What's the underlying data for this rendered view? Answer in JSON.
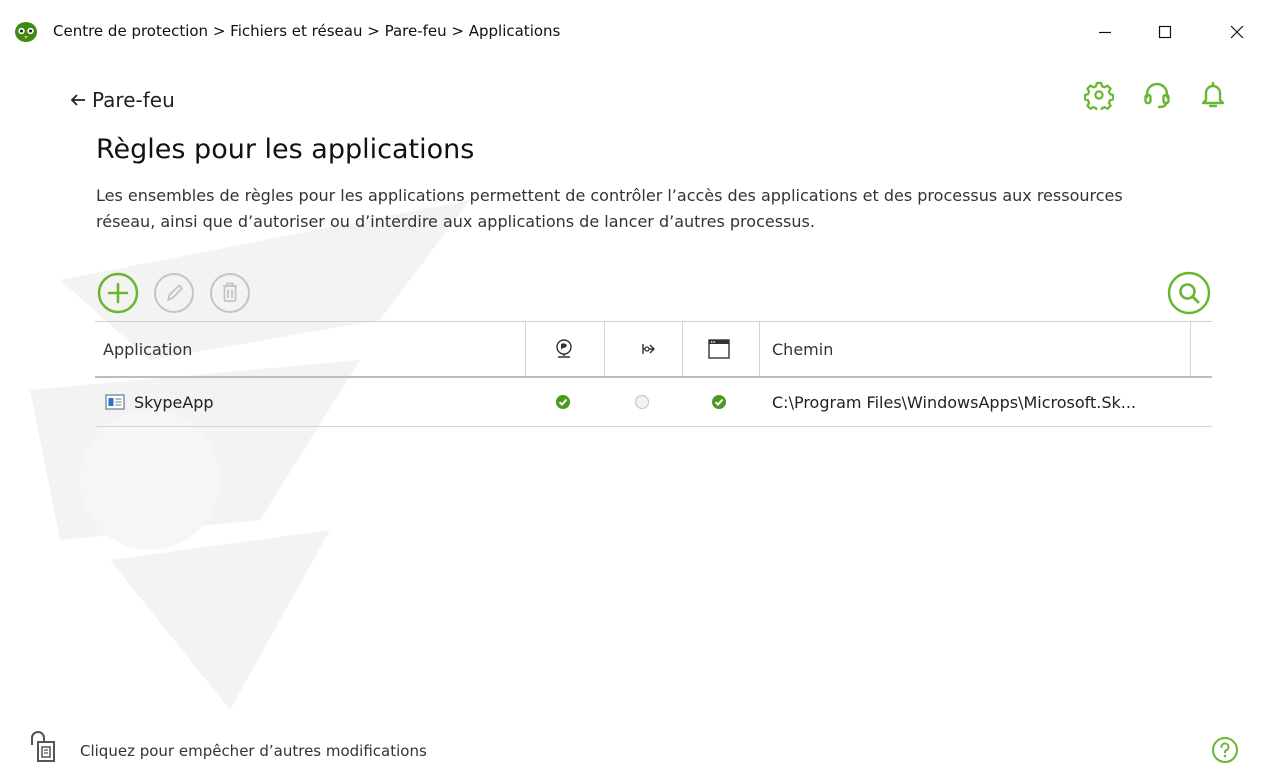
{
  "window": {
    "breadcrumb": "Centre de protection > Fichiers et réseau > Pare-feu > Applications",
    "minimize_icon": "minimize-icon",
    "maximize_icon": "maximize-icon",
    "close_icon": "close-icon"
  },
  "header": {
    "back_label": "Pare-feu",
    "settings_icon": "gear-icon",
    "support_icon": "headset-icon",
    "notifications_icon": "bell-icon"
  },
  "page": {
    "title": "Règles pour les applications",
    "description": "Les ensembles de règles pour les applications permettent de contrôler l’accès des applications et des processus aux ressources réseau, ainsi que d’autoriser ou d’interdire aux applications de lancer d’autres processus."
  },
  "toolbar": {
    "add_icon": "plus-circle-icon",
    "edit_icon": "pencil-circle-icon",
    "delete_icon": "trash-circle-icon",
    "search_icon": "search-circle-icon"
  },
  "table": {
    "columns": {
      "application": "Application",
      "network": "network-globe-icon",
      "process": "process-launch-icon",
      "window": "window-icon",
      "path": "Chemin"
    },
    "rows": [
      {
        "name": "SkypeApp",
        "icon": "app-window-icon",
        "network": "allowed",
        "process": "unset",
        "window": "allowed",
        "path": "C:\\Program Files\\WindowsApps\\Microsoft.Sk..."
      }
    ]
  },
  "status_bar": {
    "lock_text": "Cliquez pour empêcher d’autres modifications",
    "help_icon": "help-circle-icon"
  },
  "colors": {
    "accent_green": "#6ab62f",
    "disabled_gray": "#c4c4c4",
    "check_green": "#4a9a1c"
  }
}
